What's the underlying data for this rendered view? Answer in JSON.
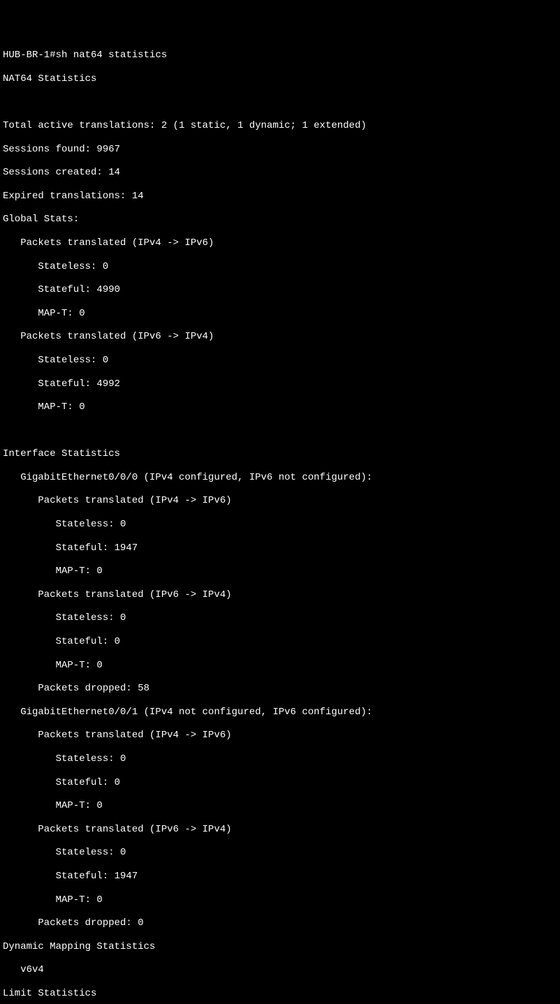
{
  "prompt": "HUB-BR-1#",
  "command": "sh nat64 statistics",
  "title": "NAT64 Statistics",
  "active_translations": "Total active translations: 2 (1 static, 1 dynamic; 1 extended)",
  "sessions_found": "Sessions found: 9967",
  "sessions_created": "Sessions created: 14",
  "expired": "Expired translations: 14",
  "global_stats_header": "Global Stats:",
  "global": {
    "v4v6_header": "   Packets translated (IPv4 -> IPv6)",
    "v4v6": {
      "stateless": "      Stateless: 0",
      "stateful": "      Stateful: 4990",
      "mapt": "      MAP-T: 0"
    },
    "v6v4_header": "   Packets translated (IPv6 -> IPv4)",
    "v6v4": {
      "stateless": "      Stateless: 0",
      "stateful": "      Stateful: 4992",
      "mapt": "      MAP-T: 0"
    }
  },
  "iface_stats_header": "Interface Statistics",
  "iface0": {
    "header": "   GigabitEthernet0/0/0 (IPv4 configured, IPv6 not configured):",
    "v4v6_header": "      Packets translated (IPv4 -> IPv6)",
    "v4v6": {
      "stateless": "         Stateless: 0",
      "stateful": "         Stateful: 1947",
      "mapt": "         MAP-T: 0"
    },
    "v6v4_header": "      Packets translated (IPv6 -> IPv4)",
    "v6v4": {
      "stateless": "         Stateless: 0",
      "stateful": "         Stateful: 0",
      "mapt": "         MAP-T: 0"
    },
    "dropped": "      Packets dropped: 58"
  },
  "iface1": {
    "header": "   GigabitEthernet0/0/1 (IPv4 not configured, IPv6 configured):",
    "v4v6_header": "      Packets translated (IPv4 -> IPv6)",
    "v4v6": {
      "stateless": "         Stateless: 0",
      "stateful": "         Stateful: 0",
      "mapt": "         MAP-T: 0"
    },
    "v6v4_header": "      Packets translated (IPv6 -> IPv4)",
    "v6v4": {
      "stateless": "         Stateless: 0",
      "stateful": "         Stateful: 1947",
      "mapt": "         MAP-T: 0"
    },
    "dropped": "      Packets dropped: 0"
  },
  "dyn_header": "Dynamic Mapping Statistics",
  "dyn_v6v4": "   v6v4",
  "limit_header": "Limit Statistics"
}
